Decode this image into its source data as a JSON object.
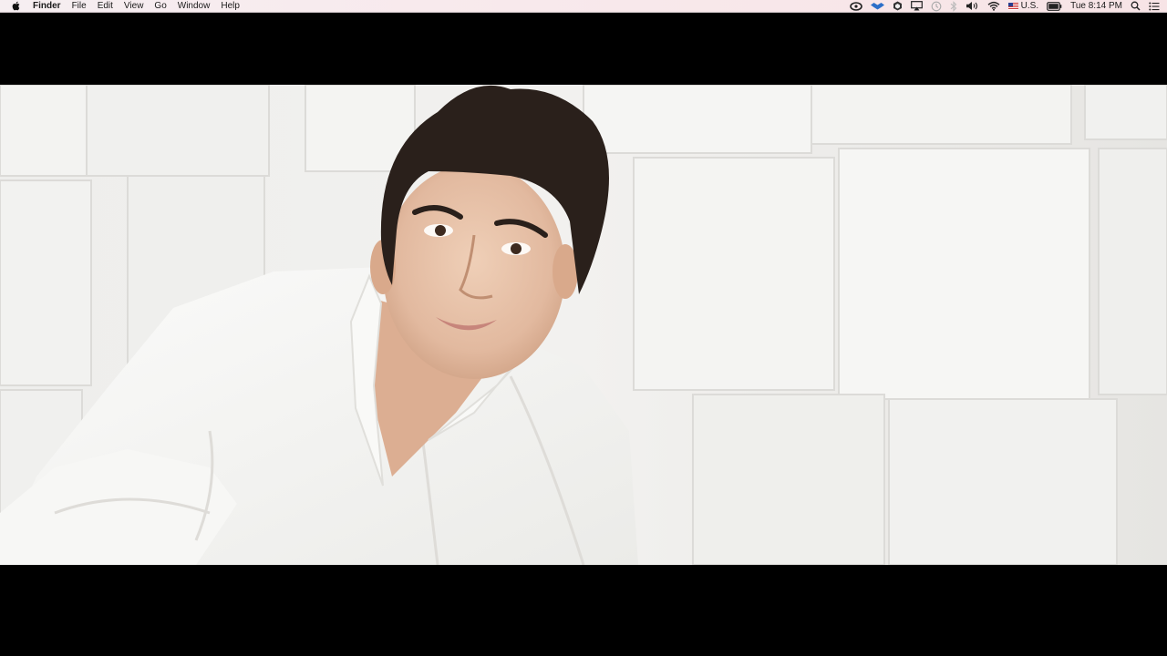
{
  "menubar": {
    "app_name": "Finder",
    "menus": [
      "File",
      "Edit",
      "View",
      "Go",
      "Window",
      "Help"
    ],
    "status_icons": [
      "creative-cloud-icon",
      "dropbox-icon",
      "app-status-icon",
      "airplay-icon",
      "time-machine-icon",
      "bluetooth-icon",
      "volume-icon",
      "wifi-icon"
    ],
    "input_source": "U.S.",
    "battery_label": "",
    "clock": "Tue 8:14 PM"
  },
  "video": {
    "description_alt": "",
    "colors": {
      "background_wall": "#ececea",
      "shirt": "#f7f7f5",
      "hair": "#2a201b",
      "skin": "#e8c4ab"
    }
  }
}
